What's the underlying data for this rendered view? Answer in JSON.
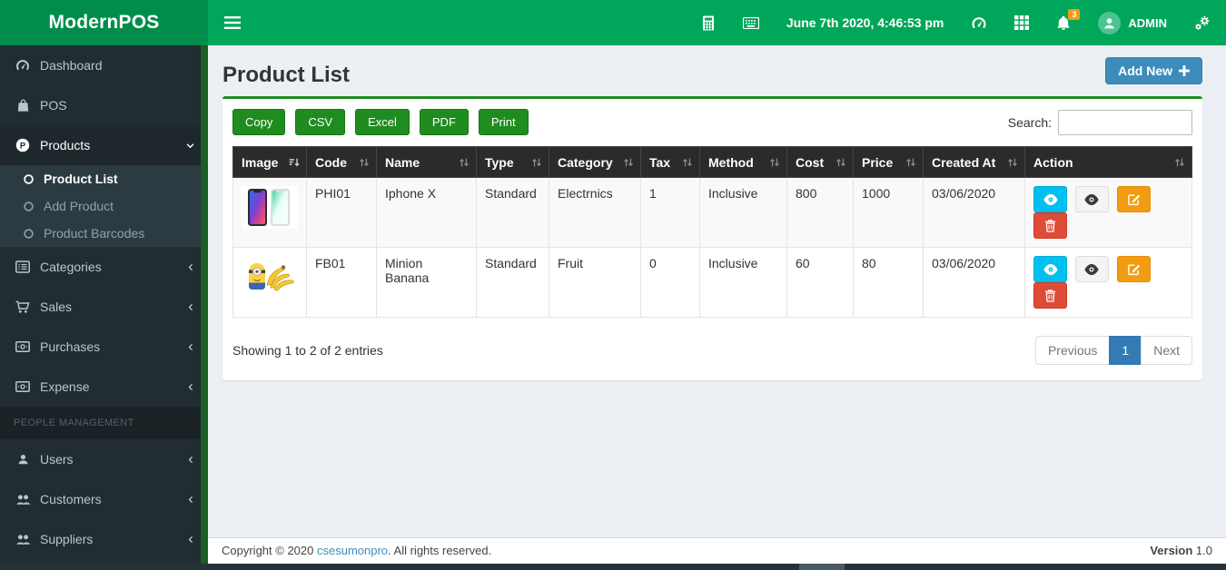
{
  "app": {
    "title": "ModernPOS"
  },
  "topbar": {
    "datetime": "June 7th 2020, 4:46:53 pm",
    "notification_count": "3",
    "user_name": "ADMIN"
  },
  "sidebar": {
    "items": [
      {
        "label": "Dashboard"
      },
      {
        "label": "POS"
      },
      {
        "label": "Products"
      },
      {
        "label": "Product List"
      },
      {
        "label": "Add Product"
      },
      {
        "label": "Product Barcodes"
      },
      {
        "label": "Categories"
      },
      {
        "label": "Sales"
      },
      {
        "label": "Purchases"
      },
      {
        "label": "Expense"
      },
      {
        "label": "Users"
      },
      {
        "label": "Customers"
      },
      {
        "label": "Suppliers"
      }
    ],
    "section_label": "PEOPLE MANAGEMENT"
  },
  "page": {
    "title": "Product List",
    "add_new_label": "Add New"
  },
  "toolbar": {
    "buttons": {
      "copy": "Copy",
      "csv": "CSV",
      "excel": "Excel",
      "pdf": "PDF",
      "print": "Print"
    },
    "search": {
      "label": "Search:",
      "value": ""
    }
  },
  "table": {
    "columns": [
      "Image",
      "Code",
      "Name",
      "Type",
      "Category",
      "Tax",
      "Method",
      "Cost",
      "Price",
      "Created At",
      "Action"
    ],
    "rows": [
      {
        "image": "iphone-x-product-photo",
        "code": "PHI01",
        "name": "Iphone X",
        "type": "Standard",
        "category": "Electrnics",
        "tax": "1",
        "method": "Inclusive",
        "cost": "800",
        "price": "1000",
        "created_at": "03/06/2020"
      },
      {
        "image": "minion-banana-product-photo",
        "code": "FB01",
        "name": "Minion Banana",
        "type": "Standard",
        "category": "Fruit",
        "tax": "0",
        "method": "Inclusive",
        "cost": "60",
        "price": "80",
        "created_at": "03/06/2020"
      }
    ],
    "summary": "Showing 1 to 2 of 2 entries"
  },
  "pagination": {
    "previous": "Previous",
    "page": "1",
    "next": "Next"
  },
  "footer": {
    "copyright_prefix": "Copyright © 2020 ",
    "link_text": "csesumonpro",
    "copyright_suffix": ". All rights reserved.",
    "version_label": "Version",
    "version_value": "1.0"
  },
  "colors": {
    "navbar_green": "#00a65a",
    "logo_green": "#008d4c",
    "button_green": "#1f8c1f",
    "sidebar_dark": "#222d32",
    "submenu_dark": "#2c3b41",
    "accent_blue": "#3c8dbc",
    "pagination_active_blue": "#337ab7",
    "info_cyan": "#00c0ef",
    "warning_orange": "#f39c12",
    "danger_red": "#dd4b39",
    "badge_orange": "#f39c12"
  }
}
